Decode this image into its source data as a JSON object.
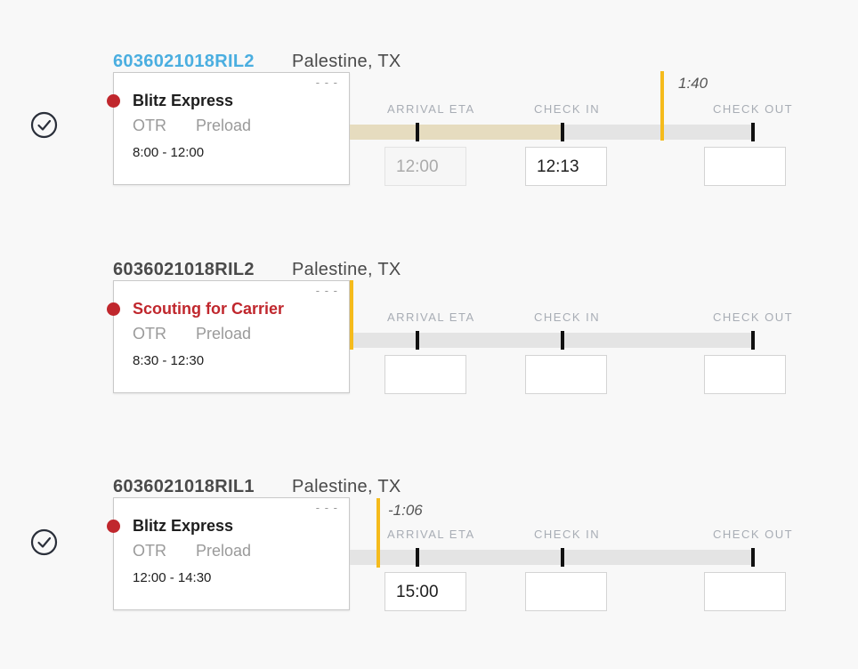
{
  "columns": {
    "arrival": "ARRIVAL ETA",
    "checkin": "CHECK IN",
    "checkout": "CHECK OUT"
  },
  "card_menu": "- - -",
  "loads": [
    {
      "id": "6036021018RIL2",
      "location": "Palestine, TX",
      "carrier": "Blitz Express",
      "mode": "OTR",
      "type": "Preload",
      "window": "8:00 - 12:00",
      "delta": "1:40",
      "arrival_eta": "12:00",
      "check_in": "12:13",
      "check_out": "",
      "completed": true,
      "progress_fraction": 0.53
    },
    {
      "id": "6036021018RIL2",
      "location": "Palestine, TX",
      "carrier": "Scouting for Carrier",
      "mode": "OTR",
      "type": "Preload",
      "window": "8:30 - 12:30",
      "delta": "",
      "arrival_eta": "",
      "check_in": "",
      "check_out": "",
      "completed": false,
      "progress_fraction": 0
    },
    {
      "id": "6036021018RIL1",
      "location": "Palestine, TX",
      "carrier": "Blitz Express",
      "mode": "OTR",
      "type": "Preload",
      "window": "12:00 - 14:30",
      "delta": "-1:06",
      "arrival_eta": "15:00",
      "check_in": "",
      "check_out": "",
      "completed": true,
      "progress_fraction": 0
    }
  ],
  "colors": {
    "link": "#4aaee0",
    "status_red": "#c0272d",
    "marker_yellow": "#f5bb1c",
    "progress_fill": "#e6dcbf",
    "track": "#e4e4e4"
  },
  "icons": {
    "completed": "check-circle-icon"
  }
}
